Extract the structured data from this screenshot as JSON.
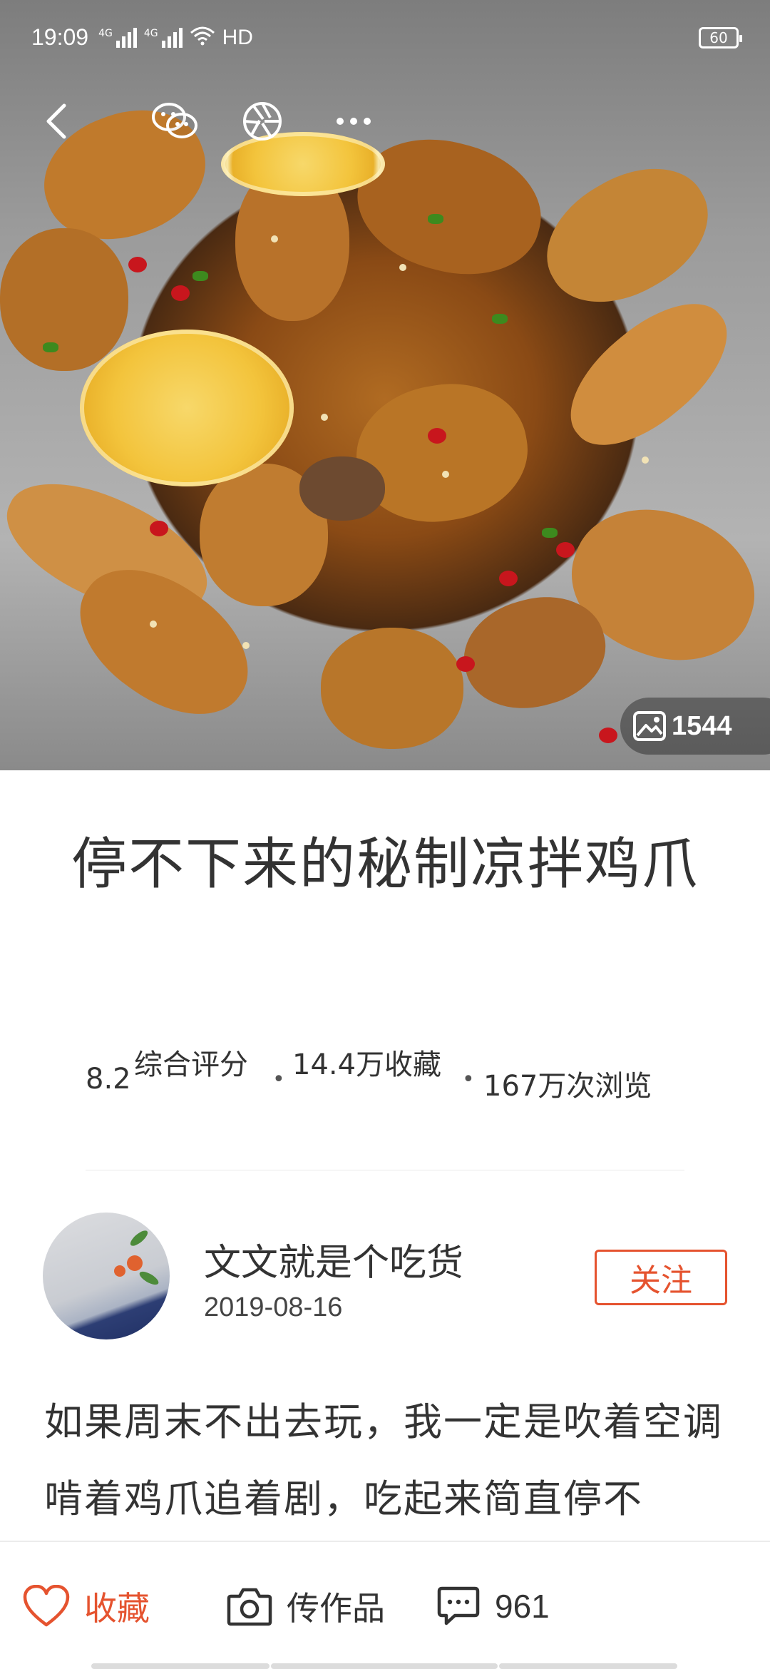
{
  "status_bar": {
    "time": "19:09",
    "net1": "4G",
    "net2": "4G",
    "hd": "HD",
    "battery": "60"
  },
  "nav": {
    "back_icon": "chevron-left-icon",
    "wechat_icon": "wechat-icon",
    "moments_icon": "aperture-icon",
    "more_icon": "more-dots-icon"
  },
  "hero": {
    "photo_count": "1544",
    "photo_icon": "image-icon"
  },
  "recipe": {
    "title": "停不下来的秘制凉拌鸡爪",
    "score": "8.2",
    "score_label": "综合评分",
    "favorites": "14.4万收藏",
    "views": "167万次浏览"
  },
  "author": {
    "name": "文文就是个吃货",
    "date": "2019-08-16",
    "follow_label": "关注"
  },
  "description": "如果周末不出去玩，我一定是吹着空调啃着鸡爪追着剧，吃起来简直停不",
  "bottom_bar": {
    "favorite_label": "收藏",
    "upload_label": "传作品",
    "comment_count": "961"
  },
  "colors": {
    "accent": "#e5532f",
    "text": "#333333"
  }
}
